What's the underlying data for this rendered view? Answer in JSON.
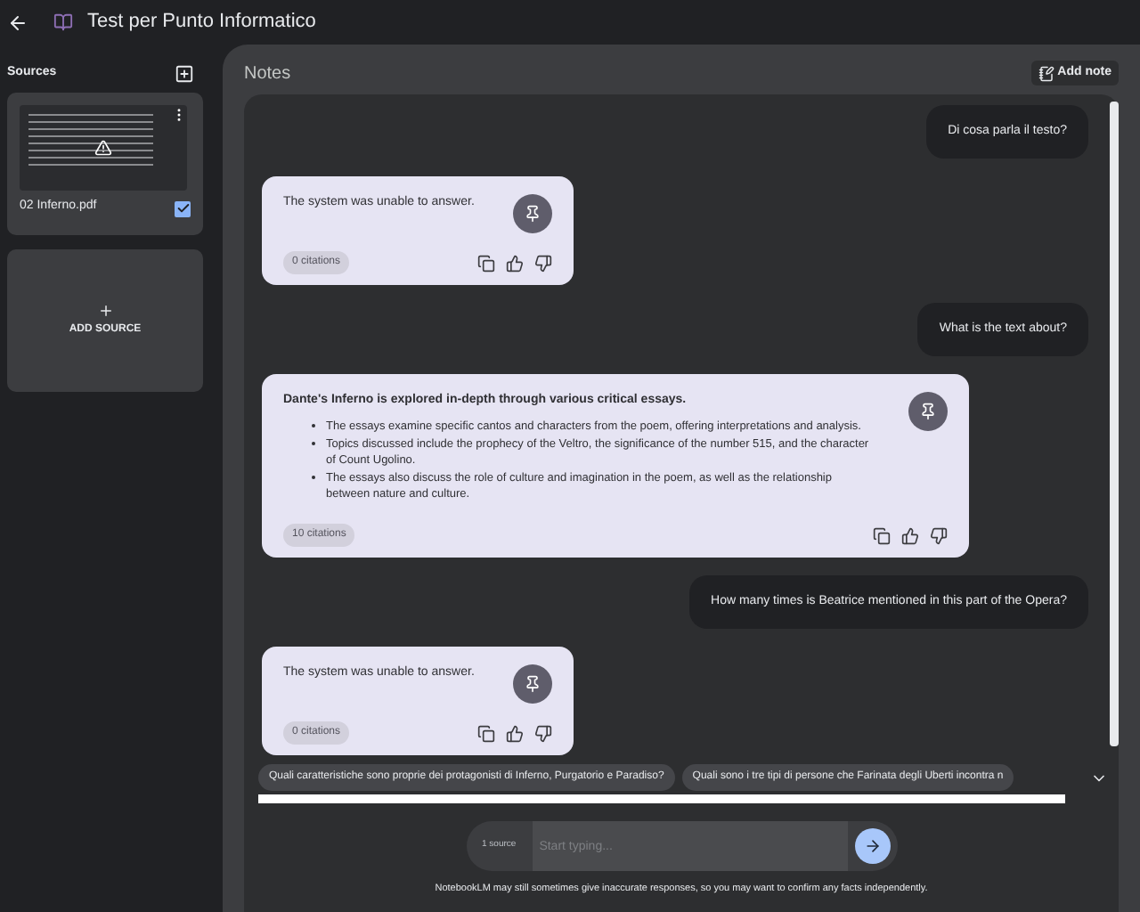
{
  "header": {
    "title": "Test per Punto Informatico"
  },
  "sidebar": {
    "heading": "Sources",
    "sources": [
      {
        "name": "02 Inferno.pdf",
        "checked": true
      }
    ],
    "add_source": "ADD SOURCE"
  },
  "notes": {
    "title": "Notes",
    "add_note": "Add note"
  },
  "messages": [
    {
      "kind": "user",
      "text": "Di cosa parla il testo?"
    },
    {
      "kind": "bot",
      "text": "The system was unable to answer.",
      "citations": "0 citations"
    },
    {
      "kind": "user",
      "text": "What is the text about?"
    },
    {
      "kind": "bot",
      "heading": "Dante's Inferno is explored in-depth through various critical essays.",
      "bullets": [
        "The essays examine specific cantos and characters from the poem, offering interpretations and analysis.",
        "Topics discussed include the prophecy of the Veltro, the significance of the number 515, and the character of Count Ugolino.",
        "The essays also discuss the role of culture and imagination in the poem, as well as the relationship between nature and culture."
      ],
      "citations": "10 citations"
    },
    {
      "kind": "user",
      "text": "How many times is Beatrice mentioned in this part of the Opera?"
    },
    {
      "kind": "bot",
      "text": "The system was unable to answer.",
      "citations": "0 citations"
    }
  ],
  "suggestions": [
    "Quali caratteristiche sono proprie dei protagonisti di Inferno, Purgatorio e Paradiso?",
    "Quali sono i tre tipi di persone che Farinata degli Uberti incontra n"
  ],
  "input": {
    "source_count": "1 source",
    "placeholder": "Start typing..."
  },
  "disclaimer": "NotebookLM may still sometimes give inaccurate responses, so you may want to confirm any facts independently."
}
